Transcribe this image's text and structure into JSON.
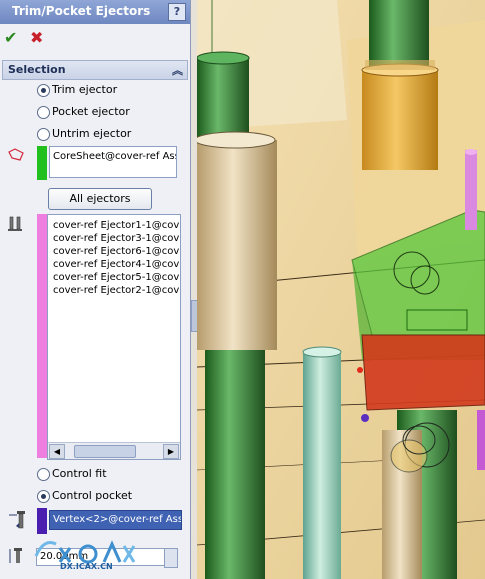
{
  "panel": {
    "title": "Trim/Pocket Ejectors",
    "help_label": "?",
    "ok_icon": "checkmark-icon",
    "cancel_icon": "x-icon",
    "selection": {
      "header": "Selection",
      "collapse_icon": "double-chevron-up-icon",
      "modes": [
        "Trim ejector",
        "Pocket ejector",
        "Untrim ejector"
      ],
      "selected_mode": "Trim ejector",
      "face_field": "CoreSheet@cover-ref Ass",
      "face_color": "#21c01f",
      "all_ejectors_button": "All ejectors",
      "ejectors_color": "#ee7fe0",
      "ejectors": [
        "cover-ref Ejector1-1@cov",
        "cover-ref Ejector3-1@cov",
        "cover-ref Ejector6-1@cov",
        "cover-ref Ejector4-1@cov",
        "cover-ref Ejector5-1@cov",
        "cover-ref Ejector2-1@cov"
      ],
      "fit_modes": [
        "Control fit",
        "Control pocket"
      ],
      "selected_fit": "Control pocket",
      "vertex_field": "Vertex<2>@cover-ref Ass",
      "vertex_color": "#4a1fb0",
      "distance_value": "20.00mm"
    }
  },
  "watermark": {
    "text": "DX.ICAX.CN"
  },
  "colors": {
    "panel_bg": "#eef0f5",
    "title_bar": "#7f97cc",
    "selection_blue": "#3f62b3"
  }
}
